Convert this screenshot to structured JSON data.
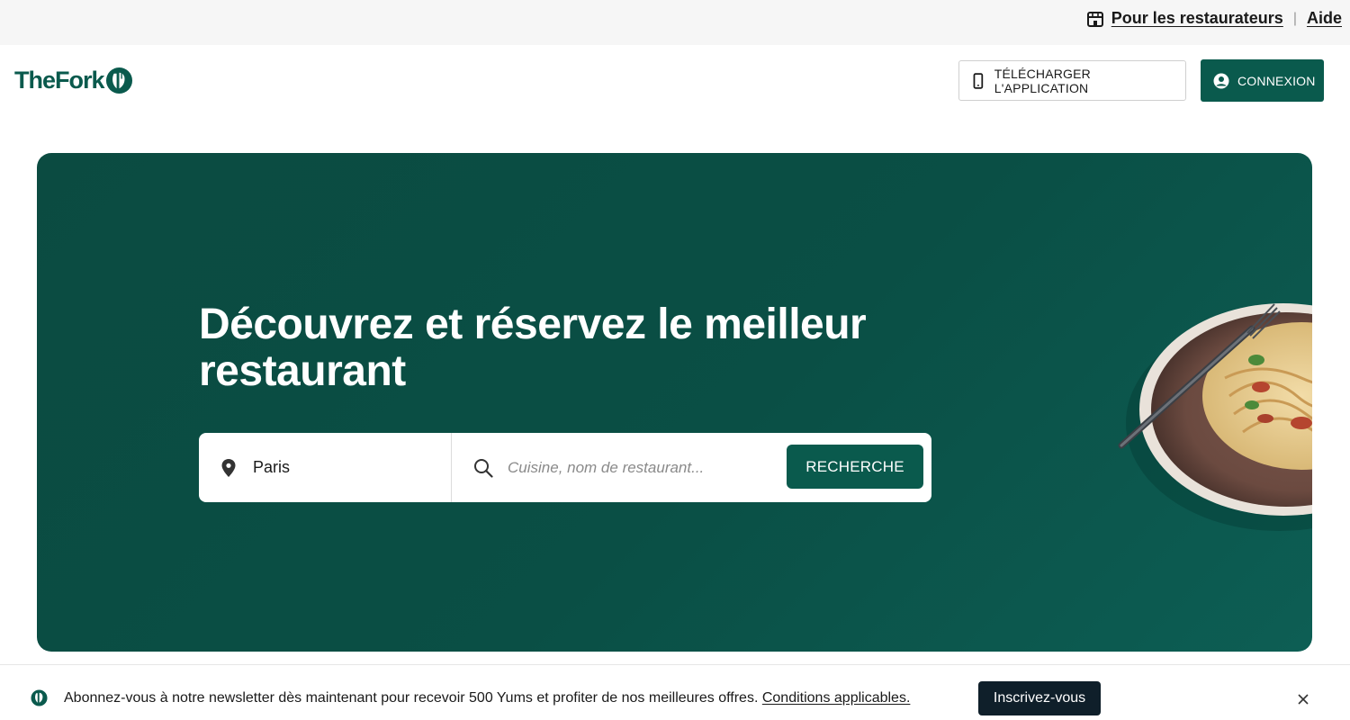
{
  "topbar": {
    "restaurateurs_label": "Pour les restaurateurs",
    "separator": "|",
    "help_label": "Aide"
  },
  "header": {
    "logo_text": "TheFork",
    "download_app_label": "TÉLÉCHARGER L'APPLICATION",
    "login_label": "CONNEXION"
  },
  "hero": {
    "title": "Découvrez et réservez le meilleur restaurant",
    "search": {
      "location_value": "Paris",
      "query_placeholder": "Cuisine, nom de restaurant...",
      "submit_label": "RECHERCHE"
    }
  },
  "newsletter": {
    "text": "Abonnez-vous à notre newsletter dès maintenant pour recevoir 500 Yums et profiter de nos meilleures offres. ",
    "link_label": "Conditions applicables.",
    "subscribe_label": "Inscrivez-vous"
  },
  "colors": {
    "brand_green": "#0a5a4d",
    "hero_bg": "#0b4b41",
    "subscribe_bg": "#0f1f2a"
  }
}
